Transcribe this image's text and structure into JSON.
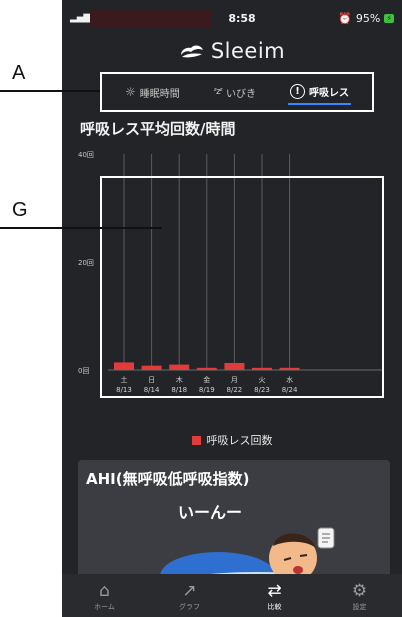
{
  "annotations": {
    "a_label": "A",
    "g_label": "G"
  },
  "status_bar": {
    "time": "8:58",
    "battery": "95%",
    "battery_badge": "⚡"
  },
  "app": {
    "logo_text": "Sleeim"
  },
  "tabs": [
    {
      "label": "睡眠時間",
      "icon": "sun-icon",
      "active": false
    },
    {
      "label": "いびき",
      "icon": "snore-zz-icon",
      "active": false
    },
    {
      "label": "呼吸レス",
      "icon": "alert-circle-icon",
      "active": true
    }
  ],
  "chart_title": "呼吸レス平均回数/時間",
  "chart_data": {
    "type": "bar",
    "y_tick_labels": [
      "40回",
      "20回",
      "0回"
    ],
    "y_ticks": [
      40,
      20,
      0
    ],
    "ylim": [
      0,
      40
    ],
    "categories": [
      {
        "day": "土",
        "date": "8/13"
      },
      {
        "day": "日",
        "date": "8/14"
      },
      {
        "day": "木",
        "date": "8/18"
      },
      {
        "day": "金",
        "date": "8/19"
      },
      {
        "day": "月",
        "date": "8/22"
      },
      {
        "day": "火",
        "date": "8/23"
      },
      {
        "day": "水",
        "date": "8/24"
      }
    ],
    "series": [
      {
        "name": "呼吸レス回数",
        "values": [
          1.4,
          0.8,
          1.0,
          0.4,
          1.3,
          0.4,
          0.4
        ]
      }
    ],
    "bar_color": "#e23b3b",
    "legend": "bottom"
  },
  "legend_label": "呼吸レス回数",
  "card": {
    "title": "AHI(無呼吸低呼吸指数)",
    "speech_text": "いーんー"
  },
  "nav": [
    {
      "label": "ホーム",
      "icon": "home-icon",
      "glyph": "⌂",
      "active": false
    },
    {
      "label": "グラフ",
      "icon": "trend-icon",
      "glyph": "↗",
      "active": false
    },
    {
      "label": "比較",
      "icon": "compare-icon",
      "glyph": "⇄",
      "active": true
    },
    {
      "label": "設定",
      "icon": "gear-icon",
      "glyph": "⚙",
      "active": false
    }
  ]
}
